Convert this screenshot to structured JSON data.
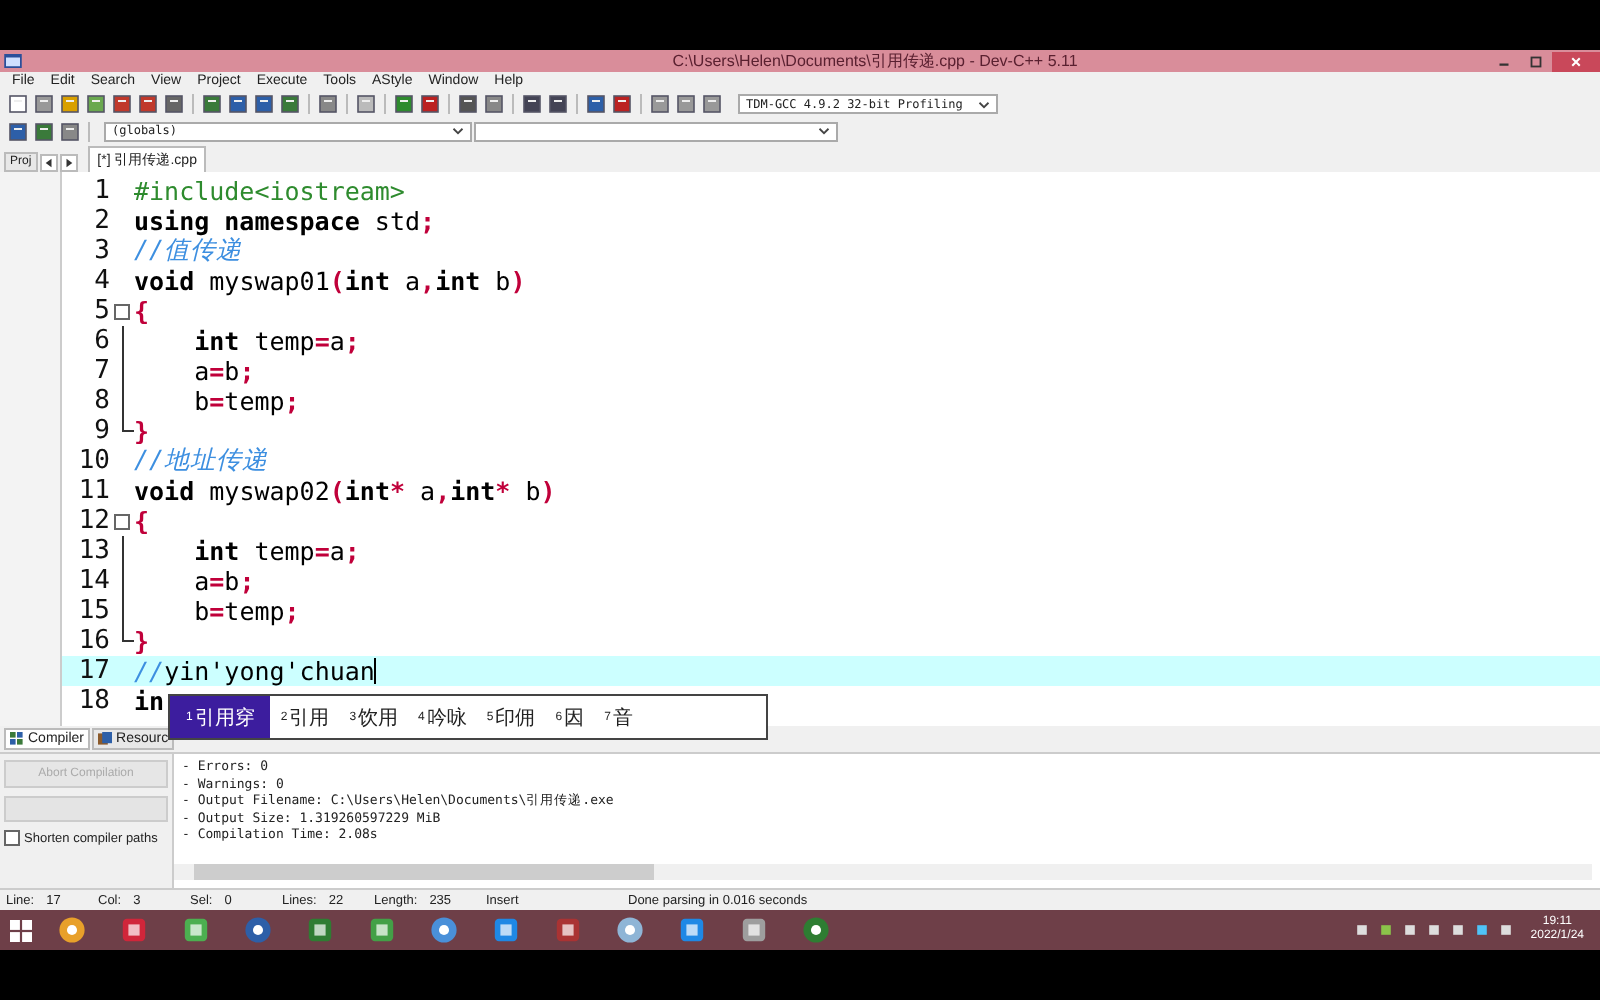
{
  "window": {
    "title": "C:\\Users\\Helen\\Documents\\引用传递.cpp - Dev-C++ 5.11"
  },
  "menu": [
    "File",
    "Edit",
    "Search",
    "View",
    "Project",
    "Execute",
    "Tools",
    "AStyle",
    "Window",
    "Help"
  ],
  "compiler_select": {
    "value": "TDM-GCC 4.9.2 32-bit Profiling"
  },
  "scope_select": {
    "value": "(globals)"
  },
  "project_tab": {
    "label": "Proj"
  },
  "tabs": [
    {
      "label": "[*] 引用传递.cpp",
      "selected": true
    }
  ],
  "editor": {
    "lines": [
      {
        "number": "1",
        "kind": "plain",
        "highlighted": false,
        "tokens": [
          {
            "kind": "preproc",
            "text": "#include<iostream>"
          }
        ]
      },
      {
        "number": "2",
        "kind": "plain",
        "highlighted": false,
        "tokens": [
          {
            "kind": "keyword",
            "text": "using namespace "
          },
          {
            "kind": "ident",
            "text": "std"
          },
          {
            "kind": "symbol",
            "text": ";"
          }
        ]
      },
      {
        "number": "3",
        "kind": "plain",
        "highlighted": false,
        "tokens": [
          {
            "kind": "comment",
            "text": "//值传递"
          }
        ]
      },
      {
        "number": "4",
        "kind": "plain",
        "highlighted": false,
        "tokens": [
          {
            "kind": "keyword",
            "text": "void "
          },
          {
            "kind": "ident",
            "text": "myswap01"
          },
          {
            "kind": "symbol",
            "text": "("
          },
          {
            "kind": "keyword",
            "text": "int "
          },
          {
            "kind": "ident",
            "text": "a"
          },
          {
            "kind": "symbol",
            "text": ","
          },
          {
            "kind": "keyword",
            "text": "int "
          },
          {
            "kind": "ident",
            "text": "b"
          },
          {
            "kind": "symbol",
            "text": ")"
          }
        ]
      },
      {
        "number": "5",
        "kind": "fold-start",
        "highlighted": false,
        "tokens": [
          {
            "kind": "symbol",
            "text": "{"
          }
        ]
      },
      {
        "number": "6",
        "kind": "fold-body",
        "highlighted": false,
        "tokens": [
          {
            "kind": "keyword",
            "text": "    int "
          },
          {
            "kind": "ident",
            "text": "temp"
          },
          {
            "kind": "symbol",
            "text": "="
          },
          {
            "kind": "ident",
            "text": "a"
          },
          {
            "kind": "symbol",
            "text": ";"
          }
        ]
      },
      {
        "number": "7",
        "kind": "fold-body",
        "highlighted": false,
        "tokens": [
          {
            "kind": "ident",
            "text": "    a"
          },
          {
            "kind": "symbol",
            "text": "="
          },
          {
            "kind": "ident",
            "text": "b"
          },
          {
            "kind": "symbol",
            "text": ";"
          }
        ]
      },
      {
        "number": "8",
        "kind": "fold-body",
        "highlighted": false,
        "tokens": [
          {
            "kind": "ident",
            "text": "    b"
          },
          {
            "kind": "symbol",
            "text": "="
          },
          {
            "kind": "ident",
            "text": "temp"
          },
          {
            "kind": "symbol",
            "text": ";"
          }
        ]
      },
      {
        "number": "9",
        "kind": "fold-end",
        "highlighted": false,
        "tokens": [
          {
            "kind": "symbol",
            "text": "}"
          }
        ]
      },
      {
        "number": "10",
        "kind": "plain",
        "highlighted": false,
        "tokens": [
          {
            "kind": "comment",
            "text": "//地址传递"
          }
        ]
      },
      {
        "number": "11",
        "kind": "plain",
        "highlighted": false,
        "tokens": [
          {
            "kind": "keyword",
            "text": "void "
          },
          {
            "kind": "ident",
            "text": "myswap02"
          },
          {
            "kind": "symbol",
            "text": "("
          },
          {
            "kind": "keyword",
            "text": "int"
          },
          {
            "kind": "symbol",
            "text": "* "
          },
          {
            "kind": "ident",
            "text": "a"
          },
          {
            "kind": "symbol",
            "text": ","
          },
          {
            "kind": "keyword",
            "text": "int"
          },
          {
            "kind": "symbol",
            "text": "* "
          },
          {
            "kind": "ident",
            "text": "b"
          },
          {
            "kind": "symbol",
            "text": ")"
          }
        ]
      },
      {
        "number": "12",
        "kind": "fold-start",
        "highlighted": false,
        "tokens": [
          {
            "kind": "symbol",
            "text": "{"
          }
        ]
      },
      {
        "number": "13",
        "kind": "fold-body",
        "highlighted": false,
        "tokens": [
          {
            "kind": "keyword",
            "text": "    int "
          },
          {
            "kind": "ident",
            "text": "temp"
          },
          {
            "kind": "symbol",
            "text": "="
          },
          {
            "kind": "ident",
            "text": "a"
          },
          {
            "kind": "symbol",
            "text": ";"
          }
        ]
      },
      {
        "number": "14",
        "kind": "fold-body",
        "highlighted": false,
        "tokens": [
          {
            "kind": "ident",
            "text": "    a"
          },
          {
            "kind": "symbol",
            "text": "="
          },
          {
            "kind": "ident",
            "text": "b"
          },
          {
            "kind": "symbol",
            "text": ";"
          }
        ]
      },
      {
        "number": "15",
        "kind": "fold-body",
        "highlighted": false,
        "tokens": [
          {
            "kind": "ident",
            "text": "    b"
          },
          {
            "kind": "symbol",
            "text": "="
          },
          {
            "kind": "ident",
            "text": "temp"
          },
          {
            "kind": "symbol",
            "text": ";"
          }
        ]
      },
      {
        "number": "16",
        "kind": "fold-end",
        "highlighted": false,
        "tokens": [
          {
            "kind": "symbol",
            "text": "}"
          }
        ]
      },
      {
        "number": "17",
        "kind": "plain",
        "highlighted": true,
        "tokens": [
          {
            "kind": "comment",
            "text": "//"
          },
          {
            "kind": "composing",
            "text": "yin'yong'chuan"
          }
        ]
      },
      {
        "number": "18",
        "kind": "plain",
        "highlighted": false,
        "tokens": [
          {
            "kind": "keyword",
            "text": "in"
          }
        ]
      }
    ]
  },
  "ime_candidates": [
    {
      "number": "1",
      "text": "引用穿",
      "selected": true
    },
    {
      "number": "2",
      "text": "引用",
      "selected": false
    },
    {
      "number": "3",
      "text": "饮用",
      "selected": false
    },
    {
      "number": "4",
      "text": "吟咏",
      "selected": false
    },
    {
      "number": "5",
      "text": "印佣",
      "selected": false
    },
    {
      "number": "6",
      "text": "因",
      "selected": false
    },
    {
      "number": "7",
      "text": "音",
      "selected": false
    }
  ],
  "bottom_tabs": [
    {
      "label": "Compiler",
      "selected": true
    },
    {
      "label": "Resourc",
      "selected": false
    }
  ],
  "compiler_panel": {
    "progress": {
      "level": 0
    },
    "abort_button": {
      "label": "Abort Compilation",
      "disabled": true
    },
    "shorten_paths": {
      "label": "Shorten compiler paths",
      "checked": false
    },
    "output": [
      "- Errors: 0",
      "- Warnings: 0",
      "- Output Filename: C:\\Users\\Helen\\Documents\\引用传递.exe",
      "- Output Size: 1.319260597229 MiB",
      "- Compilation Time: 2.08s"
    ]
  },
  "status_bar": [
    {
      "label": "Line:",
      "value": "17"
    },
    {
      "label": "Col:",
      "value": "3"
    },
    {
      "label": "Sel:",
      "value": "0"
    },
    {
      "label": "Lines:",
      "value": "22"
    },
    {
      "label": "Length:",
      "value": "235"
    },
    {
      "value": "Insert"
    },
    {
      "value": "Done parsing in 0.016 seconds"
    }
  ],
  "taskbar": {
    "time": "19:11",
    "date": "2022/1/24"
  }
}
